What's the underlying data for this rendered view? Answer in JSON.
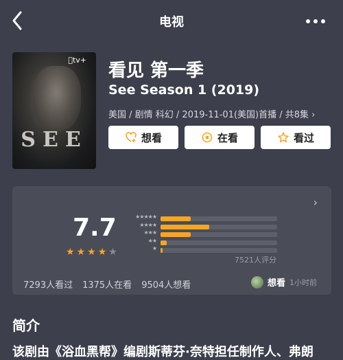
{
  "header": {
    "title": "电视",
    "back_icon": "back-chevron-icon",
    "more_icon": "more-dots-icon"
  },
  "poster": {
    "brand": "tv+",
    "word": "SEE"
  },
  "show": {
    "title": "看见 第一季",
    "subtitle": "See Season 1 (2019)",
    "meta": "美国 / 剧情 科幻 / 2019-11-01(美国)首播 / 共8集 ›"
  },
  "actions": [
    {
      "label": "想看",
      "icon": "heart-plus-icon"
    },
    {
      "label": "在看",
      "icon": "watching-circle-icon"
    },
    {
      "label": "看过",
      "icon": "star-icon"
    }
  ],
  "rating": {
    "score": "7.7",
    "stars": 4,
    "star_labels": [
      "★★★★★",
      "★★★★",
      "★★★",
      "★★",
      "★"
    ],
    "distribution": [
      0.26,
      0.42,
      0.26,
      0.05,
      0.015
    ],
    "raters": "7521人评分",
    "stats": [
      "7293人看过",
      "1375人在看",
      "9504人想看"
    ],
    "user_status": "想看",
    "user_time": "1小时前",
    "accent": "#f5a623"
  },
  "intro": {
    "heading": "简介",
    "text": "该剧由《浴血黑帮》编剧斯蒂芬·奈特担任制作人、弗朗"
  }
}
